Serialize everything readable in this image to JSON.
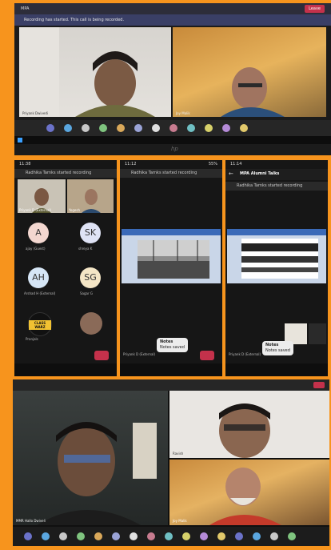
{
  "laptop": {
    "window_title": "MPA",
    "window_action": "Leave",
    "notice": "Recording has started. This call is being recorded.",
    "participants": [
      {
        "name": "Priyank Dwivedi"
      },
      {
        "name": "Joy Malik"
      }
    ],
    "brand": "hp",
    "colors": {
      "accent": "#f7941d",
      "end_call": "#c4314b"
    }
  },
  "phone1": {
    "time": "11:38",
    "banner": "Radhika Tarnks started recording",
    "tiles": [
      {
        "name": "Priyank D (External)"
      },
      {
        "name": "Yogesh"
      }
    ],
    "avatars": [
      {
        "initials": "A",
        "name": "ajay (Guest)",
        "color": "#f3d7d0"
      },
      {
        "initials": "SK",
        "name": "shreya K",
        "color": "#dfe3f5"
      },
      {
        "initials": "AH",
        "name": "Arshad H (External)",
        "color": "#d6e6f6"
      },
      {
        "initials": "SG",
        "name": "Sagar G",
        "color": "#f4e6c6"
      }
    ],
    "extra": [
      {
        "name": "Pranjals",
        "logo": "CLASS WARZ"
      },
      {
        "name": ""
      }
    ]
  },
  "phone2": {
    "time": "11:12",
    "battery": "55%",
    "banner": "Radhika Tarnks started recording",
    "participant": "Priyank D (External)",
    "toast_title": "Notes",
    "toast_body": "Notes saved"
  },
  "phone3": {
    "time": "11:14",
    "title": "MPA Alumni Talks",
    "banner": "Radhika Tarnks started recording",
    "participant": "Priyank D (External)",
    "toast_title": "Notes",
    "toast_body": "Notes saved"
  },
  "bottom": {
    "participants": [
      {
        "name": "MMR Hallo Dwiveli"
      },
      {
        "name": "Ravish"
      },
      {
        "name": "Joy Malik"
      }
    ]
  }
}
